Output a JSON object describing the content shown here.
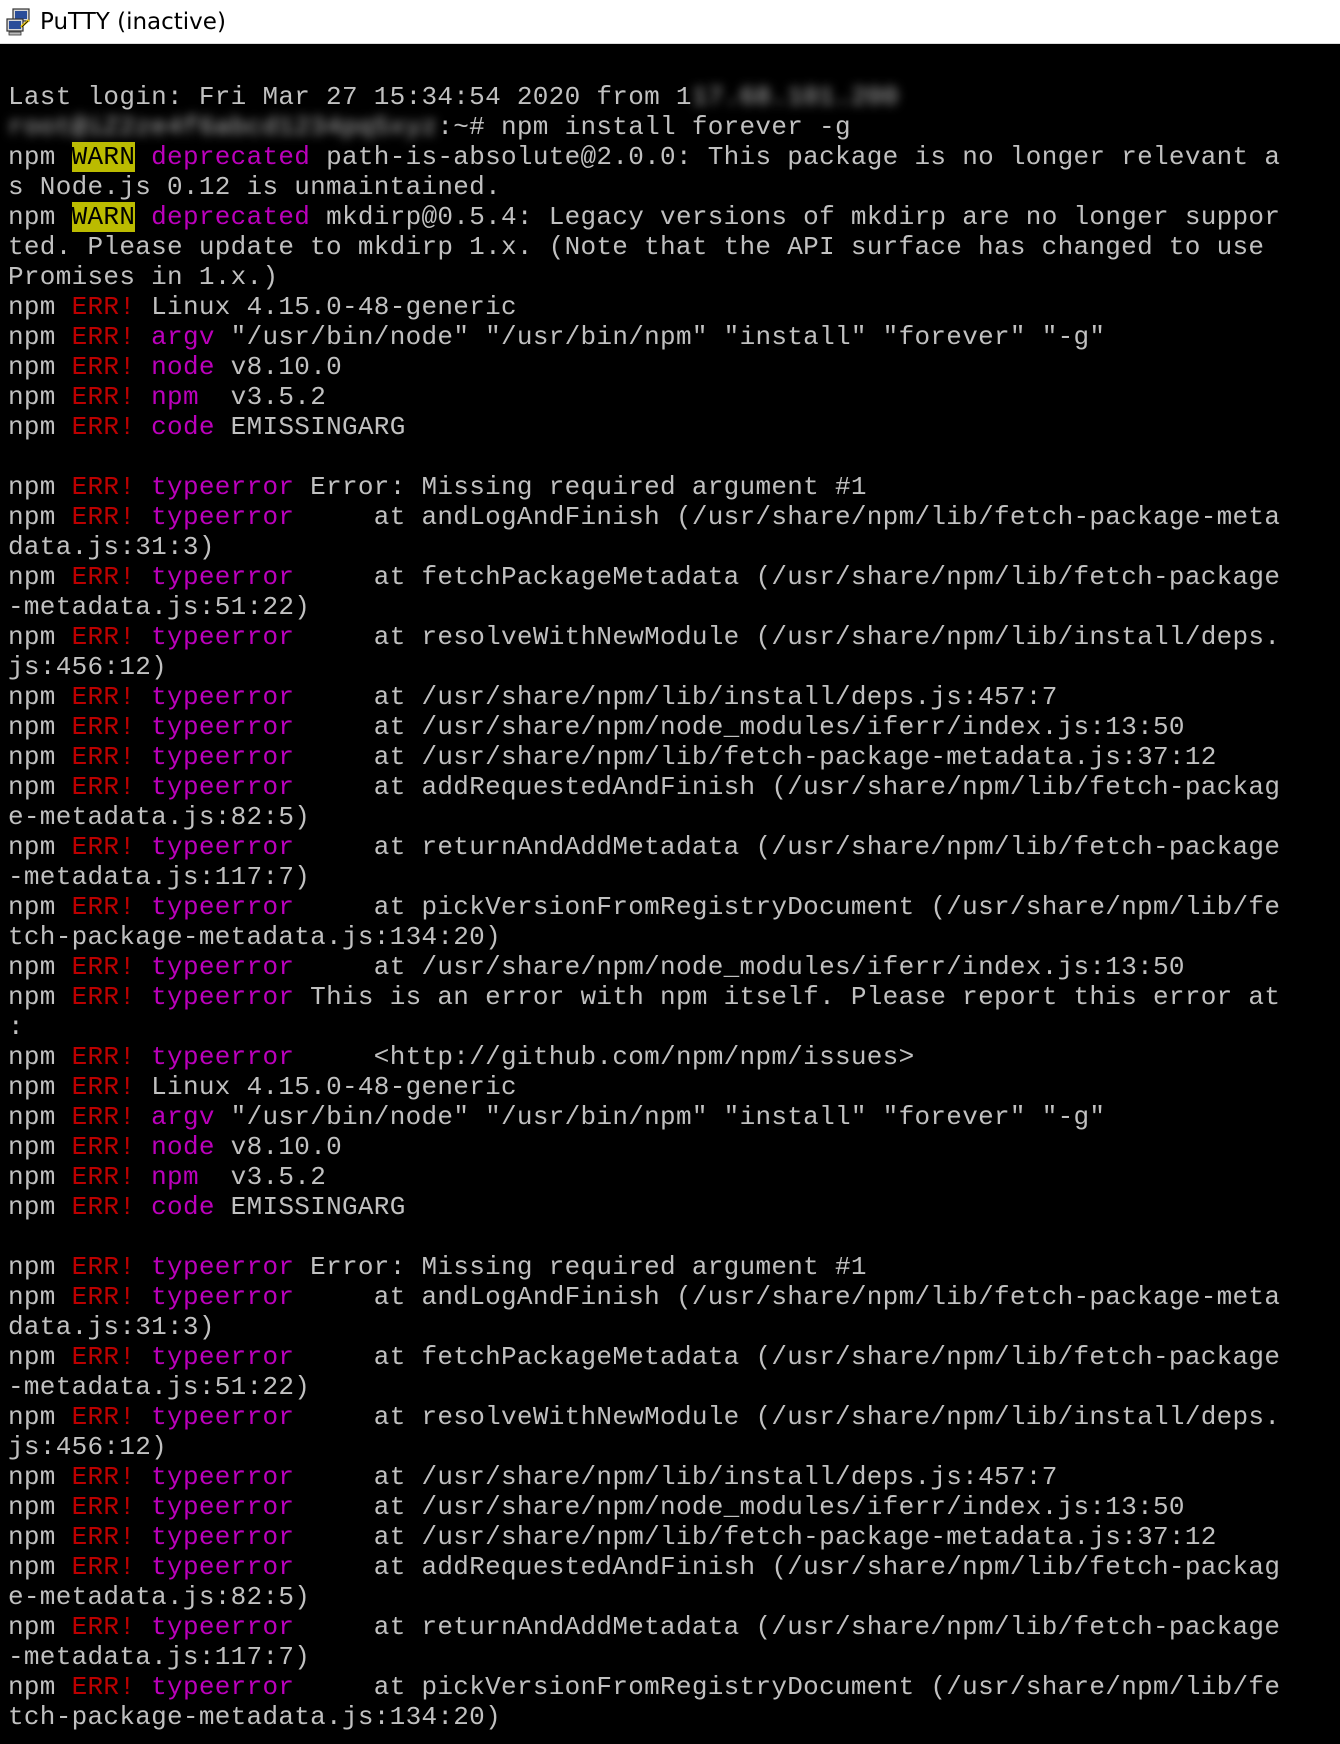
{
  "window": {
    "title": "PuTTY (inactive)",
    "icon": "putty-computers-icon"
  },
  "terminal": {
    "lines": [
      [
        {
          "t": "Last login: Fri Mar 27 15:34:54 2020 from 1"
        },
        {
          "t": "17.68.101.200",
          "s": "redact"
        }
      ],
      [
        {
          "t": "root@iZ2ze4f6abcd1234pq5xyz",
          "s": "redact"
        },
        {
          "t": ":~# npm install forever -g"
        }
      ],
      [
        {
          "t": "npm "
        },
        {
          "t": "WARN",
          "s": "warn"
        },
        {
          "t": " "
        },
        {
          "t": "deprecated",
          "s": "mag"
        },
        {
          "t": " path-is-absolute@2.0.0: This package is no longer relevant a"
        }
      ],
      [
        {
          "t": "s Node.js 0.12 is unmaintained."
        }
      ],
      [
        {
          "t": "npm "
        },
        {
          "t": "WARN",
          "s": "warn"
        },
        {
          "t": " "
        },
        {
          "t": "deprecated",
          "s": "mag"
        },
        {
          "t": " mkdirp@0.5.4: Legacy versions of mkdirp are no longer suppor"
        }
      ],
      [
        {
          "t": "ted. Please update to mkdirp 1.x. (Note that the API surface has changed to use"
        }
      ],
      [
        {
          "t": "Promises in 1.x.)"
        }
      ],
      [
        {
          "t": "npm "
        },
        {
          "t": "ERR!",
          "s": "err"
        },
        {
          "t": " Linux 4.15.0-48-generic"
        }
      ],
      [
        {
          "t": "npm "
        },
        {
          "t": "ERR!",
          "s": "err"
        },
        {
          "t": " "
        },
        {
          "t": "argv",
          "s": "mag"
        },
        {
          "t": " \"/usr/bin/node\" \"/usr/bin/npm\" \"install\" \"forever\" \"-g\""
        }
      ],
      [
        {
          "t": "npm "
        },
        {
          "t": "ERR!",
          "s": "err"
        },
        {
          "t": " "
        },
        {
          "t": "node",
          "s": "mag"
        },
        {
          "t": " v8.10.0"
        }
      ],
      [
        {
          "t": "npm "
        },
        {
          "t": "ERR!",
          "s": "err"
        },
        {
          "t": " "
        },
        {
          "t": "npm",
          "s": "mag"
        },
        {
          "t": "  v3.5.2"
        }
      ],
      [
        {
          "t": "npm "
        },
        {
          "t": "ERR!",
          "s": "err"
        },
        {
          "t": " "
        },
        {
          "t": "code",
          "s": "mag"
        },
        {
          "t": " EMISSINGARG"
        }
      ],
      [],
      [
        {
          "t": "npm "
        },
        {
          "t": "ERR!",
          "s": "err"
        },
        {
          "t": " "
        },
        {
          "t": "typeerror",
          "s": "mag"
        },
        {
          "t": " Error: Missing required argument #1"
        }
      ],
      [
        {
          "t": "npm "
        },
        {
          "t": "ERR!",
          "s": "err"
        },
        {
          "t": " "
        },
        {
          "t": "typeerror",
          "s": "mag"
        },
        {
          "t": "     at andLogAndFinish (/usr/share/npm/lib/fetch-package-meta"
        }
      ],
      [
        {
          "t": "data.js:31:3)"
        }
      ],
      [
        {
          "t": "npm "
        },
        {
          "t": "ERR!",
          "s": "err"
        },
        {
          "t": " "
        },
        {
          "t": "typeerror",
          "s": "mag"
        },
        {
          "t": "     at fetchPackageMetadata (/usr/share/npm/lib/fetch-package"
        }
      ],
      [
        {
          "t": "-metadata.js:51:22)"
        }
      ],
      [
        {
          "t": "npm "
        },
        {
          "t": "ERR!",
          "s": "err"
        },
        {
          "t": " "
        },
        {
          "t": "typeerror",
          "s": "mag"
        },
        {
          "t": "     at resolveWithNewModule (/usr/share/npm/lib/install/deps."
        }
      ],
      [
        {
          "t": "js:456:12)"
        }
      ],
      [
        {
          "t": "npm "
        },
        {
          "t": "ERR!",
          "s": "err"
        },
        {
          "t": " "
        },
        {
          "t": "typeerror",
          "s": "mag"
        },
        {
          "t": "     at /usr/share/npm/lib/install/deps.js:457:7"
        }
      ],
      [
        {
          "t": "npm "
        },
        {
          "t": "ERR!",
          "s": "err"
        },
        {
          "t": " "
        },
        {
          "t": "typeerror",
          "s": "mag"
        },
        {
          "t": "     at /usr/share/npm/node_modules/iferr/index.js:13:50"
        }
      ],
      [
        {
          "t": "npm "
        },
        {
          "t": "ERR!",
          "s": "err"
        },
        {
          "t": " "
        },
        {
          "t": "typeerror",
          "s": "mag"
        },
        {
          "t": "     at /usr/share/npm/lib/fetch-package-metadata.js:37:12"
        }
      ],
      [
        {
          "t": "npm "
        },
        {
          "t": "ERR!",
          "s": "err"
        },
        {
          "t": " "
        },
        {
          "t": "typeerror",
          "s": "mag"
        },
        {
          "t": "     at addRequestedAndFinish (/usr/share/npm/lib/fetch-packag"
        }
      ],
      [
        {
          "t": "e-metadata.js:82:5)"
        }
      ],
      [
        {
          "t": "npm "
        },
        {
          "t": "ERR!",
          "s": "err"
        },
        {
          "t": " "
        },
        {
          "t": "typeerror",
          "s": "mag"
        },
        {
          "t": "     at returnAndAddMetadata (/usr/share/npm/lib/fetch-package"
        }
      ],
      [
        {
          "t": "-metadata.js:117:7)"
        }
      ],
      [
        {
          "t": "npm "
        },
        {
          "t": "ERR!",
          "s": "err"
        },
        {
          "t": " "
        },
        {
          "t": "typeerror",
          "s": "mag"
        },
        {
          "t": "     at pickVersionFromRegistryDocument (/usr/share/npm/lib/fe"
        }
      ],
      [
        {
          "t": "tch-package-metadata.js:134:20)"
        }
      ],
      [
        {
          "t": "npm "
        },
        {
          "t": "ERR!",
          "s": "err"
        },
        {
          "t": " "
        },
        {
          "t": "typeerror",
          "s": "mag"
        },
        {
          "t": "     at /usr/share/npm/node_modules/iferr/index.js:13:50"
        }
      ],
      [
        {
          "t": "npm "
        },
        {
          "t": "ERR!",
          "s": "err"
        },
        {
          "t": " "
        },
        {
          "t": "typeerror",
          "s": "mag"
        },
        {
          "t": " This is an error with npm itself. Please report this error at"
        }
      ],
      [
        {
          "t": ":"
        }
      ],
      [
        {
          "t": "npm "
        },
        {
          "t": "ERR!",
          "s": "err"
        },
        {
          "t": " "
        },
        {
          "t": "typeerror",
          "s": "mag"
        },
        {
          "t": "     <http://github.com/npm/npm/issues>"
        }
      ],
      [
        {
          "t": "npm "
        },
        {
          "t": "ERR!",
          "s": "err"
        },
        {
          "t": " Linux 4.15.0-48-generic"
        }
      ],
      [
        {
          "t": "npm "
        },
        {
          "t": "ERR!",
          "s": "err"
        },
        {
          "t": " "
        },
        {
          "t": "argv",
          "s": "mag"
        },
        {
          "t": " \"/usr/bin/node\" \"/usr/bin/npm\" \"install\" \"forever\" \"-g\""
        }
      ],
      [
        {
          "t": "npm "
        },
        {
          "t": "ERR!",
          "s": "err"
        },
        {
          "t": " "
        },
        {
          "t": "node",
          "s": "mag"
        },
        {
          "t": " v8.10.0"
        }
      ],
      [
        {
          "t": "npm "
        },
        {
          "t": "ERR!",
          "s": "err"
        },
        {
          "t": " "
        },
        {
          "t": "npm",
          "s": "mag"
        },
        {
          "t": "  v3.5.2"
        }
      ],
      [
        {
          "t": "npm "
        },
        {
          "t": "ERR!",
          "s": "err"
        },
        {
          "t": " "
        },
        {
          "t": "code",
          "s": "mag"
        },
        {
          "t": " EMISSINGARG"
        }
      ],
      [],
      [
        {
          "t": "npm "
        },
        {
          "t": "ERR!",
          "s": "err"
        },
        {
          "t": " "
        },
        {
          "t": "typeerror",
          "s": "mag"
        },
        {
          "t": " Error: Missing required argument #1"
        }
      ],
      [
        {
          "t": "npm "
        },
        {
          "t": "ERR!",
          "s": "err"
        },
        {
          "t": " "
        },
        {
          "t": "typeerror",
          "s": "mag"
        },
        {
          "t": "     at andLogAndFinish (/usr/share/npm/lib/fetch-package-meta"
        }
      ],
      [
        {
          "t": "data.js:31:3)"
        }
      ],
      [
        {
          "t": "npm "
        },
        {
          "t": "ERR!",
          "s": "err"
        },
        {
          "t": " "
        },
        {
          "t": "typeerror",
          "s": "mag"
        },
        {
          "t": "     at fetchPackageMetadata (/usr/share/npm/lib/fetch-package"
        }
      ],
      [
        {
          "t": "-metadata.js:51:22)"
        }
      ],
      [
        {
          "t": "npm "
        },
        {
          "t": "ERR!",
          "s": "err"
        },
        {
          "t": " "
        },
        {
          "t": "typeerror",
          "s": "mag"
        },
        {
          "t": "     at resolveWithNewModule (/usr/share/npm/lib/install/deps."
        }
      ],
      [
        {
          "t": "js:456:12)"
        }
      ],
      [
        {
          "t": "npm "
        },
        {
          "t": "ERR!",
          "s": "err"
        },
        {
          "t": " "
        },
        {
          "t": "typeerror",
          "s": "mag"
        },
        {
          "t": "     at /usr/share/npm/lib/install/deps.js:457:7"
        }
      ],
      [
        {
          "t": "npm "
        },
        {
          "t": "ERR!",
          "s": "err"
        },
        {
          "t": " "
        },
        {
          "t": "typeerror",
          "s": "mag"
        },
        {
          "t": "     at /usr/share/npm/node_modules/iferr/index.js:13:50"
        }
      ],
      [
        {
          "t": "npm "
        },
        {
          "t": "ERR!",
          "s": "err"
        },
        {
          "t": " "
        },
        {
          "t": "typeerror",
          "s": "mag"
        },
        {
          "t": "     at /usr/share/npm/lib/fetch-package-metadata.js:37:12"
        }
      ],
      [
        {
          "t": "npm "
        },
        {
          "t": "ERR!",
          "s": "err"
        },
        {
          "t": " "
        },
        {
          "t": "typeerror",
          "s": "mag"
        },
        {
          "t": "     at addRequestedAndFinish (/usr/share/npm/lib/fetch-packag"
        }
      ],
      [
        {
          "t": "e-metadata.js:82:5)"
        }
      ],
      [
        {
          "t": "npm "
        },
        {
          "t": "ERR!",
          "s": "err"
        },
        {
          "t": " "
        },
        {
          "t": "typeerror",
          "s": "mag"
        },
        {
          "t": "     at returnAndAddMetadata (/usr/share/npm/lib/fetch-package"
        }
      ],
      [
        {
          "t": "-metadata.js:117:7)"
        }
      ],
      [
        {
          "t": "npm "
        },
        {
          "t": "ERR!",
          "s": "err"
        },
        {
          "t": " "
        },
        {
          "t": "typeerror",
          "s": "mag"
        },
        {
          "t": "     at pickVersionFromRegistryDocument (/usr/share/npm/lib/fe"
        }
      ],
      [
        {
          "t": "tch-package-metadata.js:134:20)"
        }
      ]
    ]
  },
  "colors": {
    "background": "#000000",
    "foreground": "#c0c0c0",
    "warn_bg": "#bbbb00",
    "err": "#bb0000",
    "magenta": "#bb00bb",
    "titlebar": "#ffffff"
  }
}
